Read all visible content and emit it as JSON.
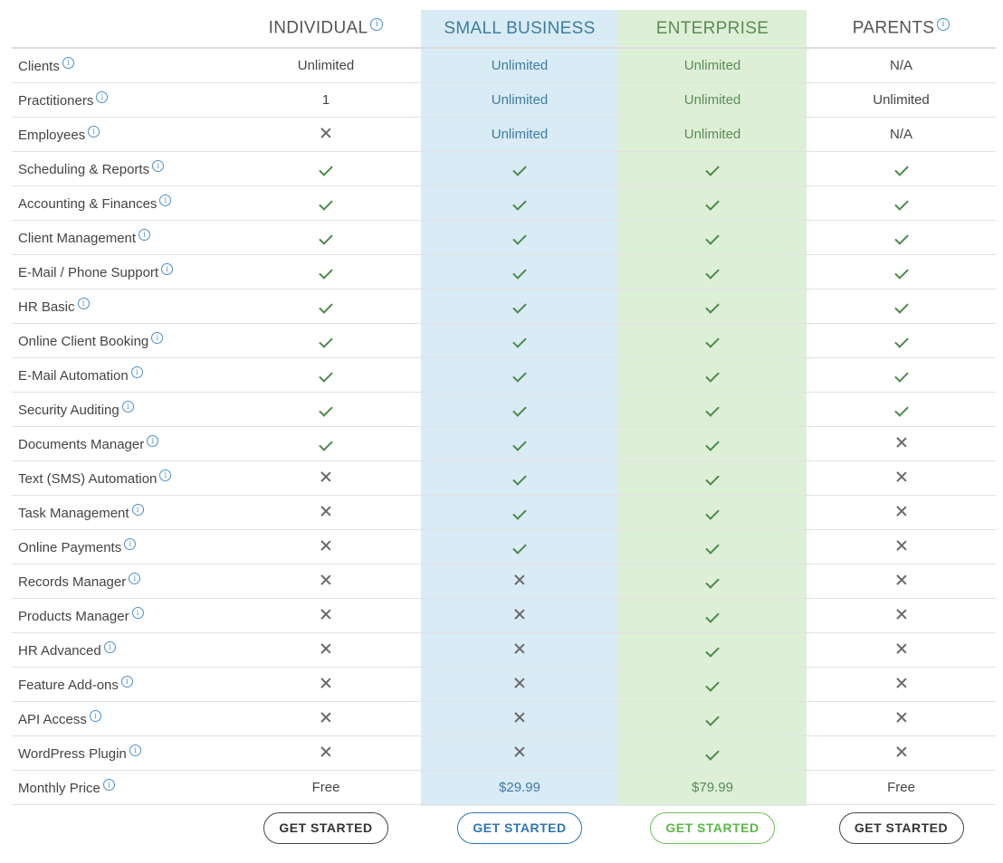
{
  "plans": [
    {
      "key": "individual",
      "name": "INDIVIDUAL",
      "has_info": true,
      "button": "GET STARTED"
    },
    {
      "key": "small_business",
      "name": "SMALL BUSINESS",
      "has_info": false,
      "button": "GET STARTED"
    },
    {
      "key": "enterprise",
      "name": "ENTERPRISE",
      "has_info": false,
      "button": "GET STARTED"
    },
    {
      "key": "parents",
      "name": "PARENTS",
      "has_info": true,
      "button": "GET STARTED"
    }
  ],
  "info_glyph": "i",
  "features": [
    {
      "label": "Clients",
      "values": [
        "Unlimited",
        "Unlimited",
        "Unlimited",
        "N/A"
      ]
    },
    {
      "label": "Practitioners",
      "values": [
        "1",
        "Unlimited",
        "Unlimited",
        "Unlimited"
      ]
    },
    {
      "label": "Employees",
      "values": [
        "no",
        "Unlimited",
        "Unlimited",
        "N/A"
      ]
    },
    {
      "label": "Scheduling & Reports",
      "values": [
        "yes",
        "yes",
        "yes",
        "yes"
      ]
    },
    {
      "label": "Accounting & Finances",
      "values": [
        "yes",
        "yes",
        "yes",
        "yes"
      ]
    },
    {
      "label": "Client Management",
      "values": [
        "yes",
        "yes",
        "yes",
        "yes"
      ]
    },
    {
      "label": "E-Mail / Phone Support",
      "values": [
        "yes",
        "yes",
        "yes",
        "yes"
      ]
    },
    {
      "label": "HR Basic",
      "values": [
        "yes",
        "yes",
        "yes",
        "yes"
      ]
    },
    {
      "label": "Online Client Booking",
      "values": [
        "yes",
        "yes",
        "yes",
        "yes"
      ]
    },
    {
      "label": "E-Mail Automation",
      "values": [
        "yes",
        "yes",
        "yes",
        "yes"
      ]
    },
    {
      "label": "Security Auditing",
      "values": [
        "yes",
        "yes",
        "yes",
        "yes"
      ]
    },
    {
      "label": "Documents Manager",
      "values": [
        "yes",
        "yes",
        "yes",
        "no"
      ]
    },
    {
      "label": "Text (SMS) Automation",
      "values": [
        "no",
        "yes",
        "yes",
        "no"
      ]
    },
    {
      "label": "Task Management",
      "values": [
        "no",
        "yes",
        "yes",
        "no"
      ]
    },
    {
      "label": "Online Payments",
      "values": [
        "no",
        "yes",
        "yes",
        "no"
      ]
    },
    {
      "label": "Records Manager",
      "values": [
        "no",
        "no",
        "yes",
        "no"
      ]
    },
    {
      "label": "Products Manager",
      "values": [
        "no",
        "no",
        "yes",
        "no"
      ]
    },
    {
      "label": "HR Advanced",
      "values": [
        "no",
        "no",
        "yes",
        "no"
      ]
    },
    {
      "label": "Feature Add-ons",
      "values": [
        "no",
        "no",
        "yes",
        "no"
      ]
    },
    {
      "label": "API Access",
      "values": [
        "no",
        "no",
        "yes",
        "no"
      ]
    },
    {
      "label": "WordPress Plugin",
      "values": [
        "no",
        "no",
        "yes",
        "no"
      ]
    },
    {
      "label": "Monthly Price",
      "values": [
        "Free",
        "$29.99",
        "$79.99",
        "Free"
      ]
    }
  ],
  "colors": {
    "small_business_bg": "#d9ebf5",
    "enterprise_bg": "#deefd8",
    "small_business_accent": "#2f75b5",
    "enterprise_accent": "#6cc25a",
    "check": "#4c8a4a",
    "info": "#4a90c8"
  }
}
